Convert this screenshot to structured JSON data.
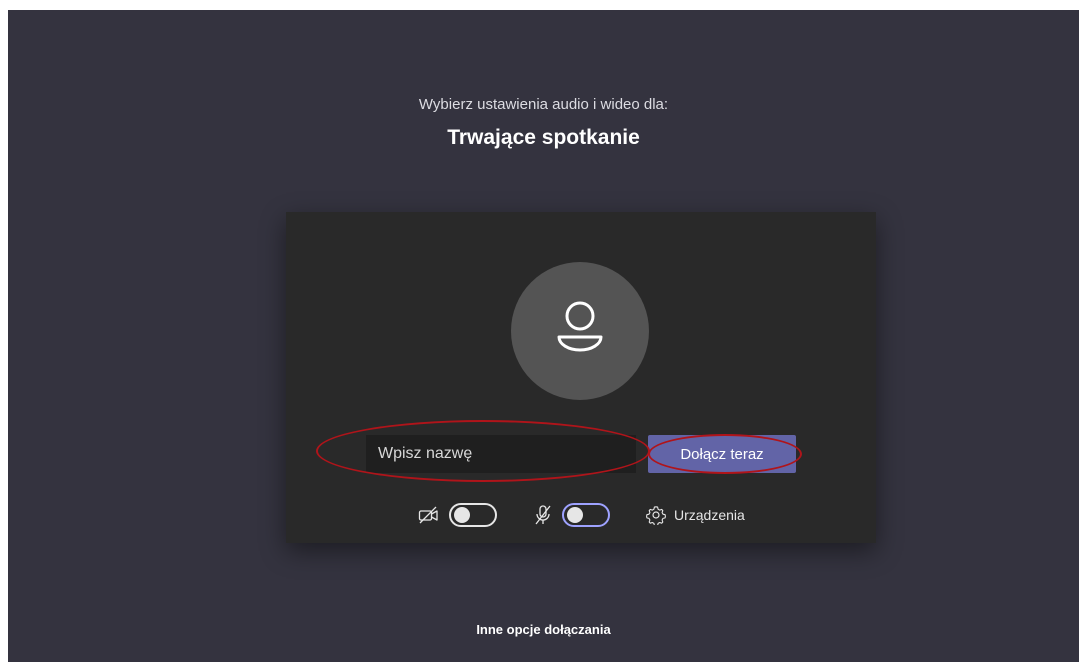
{
  "prejoin": {
    "subtitle": "Wybierz ustawienia audio i wideo dla:",
    "meeting_title": "Trwające spotkanie"
  },
  "card": {
    "avatar_icon": "person-icon",
    "name_input": {
      "value": "",
      "placeholder": "Wpisz nazwę"
    },
    "join_button_label": "Dołącz teraz",
    "controls": {
      "camera": {
        "icon": "camera-off-icon",
        "state": "off"
      },
      "microphone": {
        "icon": "mic-off-icon",
        "state": "off"
      },
      "devices": {
        "icon": "gear-icon",
        "label": "Urządzenia"
      }
    }
  },
  "footer": {
    "other_options_label": "Inne opcje dołączania"
  },
  "annotations": {
    "highlight_color": "#b0141a"
  },
  "colors": {
    "background": "#34333f",
    "card": "#292929",
    "accent": "#6264a7"
  }
}
